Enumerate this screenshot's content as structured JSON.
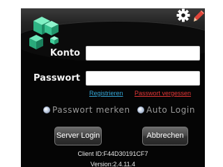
{
  "form": {
    "konto_label": "Konto",
    "konto_value": "",
    "passwort_label": "Passwort",
    "passwort_value": ""
  },
  "links": {
    "register": "Registrieren",
    "forgot_password": "Passwort vergessen"
  },
  "options": {
    "remember_label": "Passwort  merken",
    "auto_login_label": "Auto  Login"
  },
  "buttons": {
    "server_login": "Server Login",
    "cancel": "Abbrechen"
  },
  "footer": {
    "client_id": "Client ID:F44D30191CF7",
    "version": "Version:2.4.11.4"
  },
  "icons": {
    "logo": "green-cubes-logo-icon",
    "settings": "gear-icon",
    "edit": "pencil-icon"
  },
  "colors": {
    "background": "#050505",
    "register_link": "#35a6d6",
    "forgot_link": "#e33737",
    "logo_green": "#3fcf9a",
    "pencil_red": "#e0453a"
  }
}
